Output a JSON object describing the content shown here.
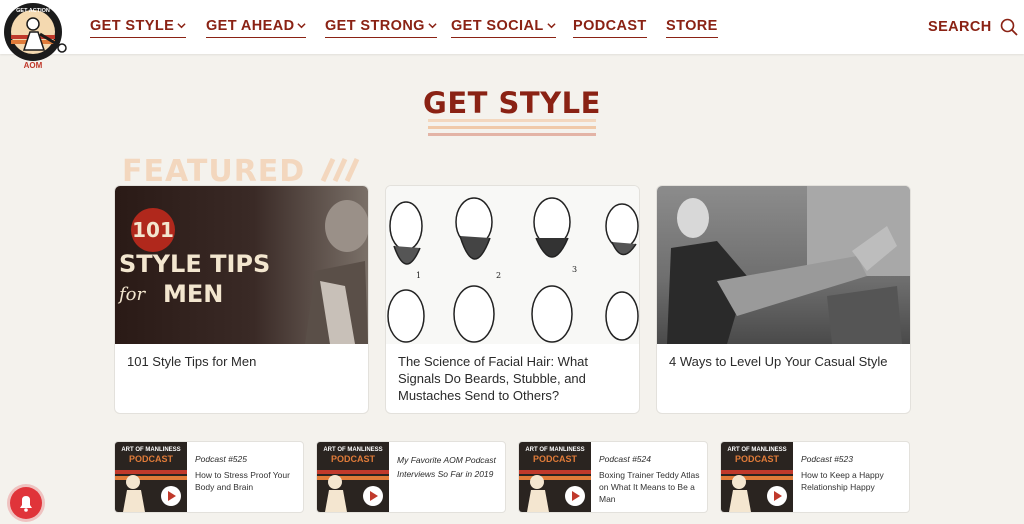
{
  "logo": {
    "text": "GET ACTION",
    "brand": "AOM"
  },
  "nav": {
    "items": [
      {
        "label": "GET STYLE",
        "has_menu": true
      },
      {
        "label": "GET AHEAD",
        "has_menu": true
      },
      {
        "label": "GET STRONG",
        "has_menu": true
      },
      {
        "label": "GET SOCIAL",
        "has_menu": true
      },
      {
        "label": "PODCAST",
        "has_menu": false
      },
      {
        "label": "STORE",
        "has_menu": false
      }
    ],
    "search_label": "SEARCH"
  },
  "page": {
    "title": "GET STYLE",
    "featured_label": "FEATURED"
  },
  "featured_cards": [
    {
      "title": "101 Style Tips for Men",
      "thumb_number": "101",
      "thumb_line1": "STYLE TIPS",
      "thumb_for": "for",
      "thumb_line2": "MEN"
    },
    {
      "title": "The Science of Facial Hair: What Signals Do Beards, Stubble, and Mustaches Send to Others?",
      "thumb_nums": [
        "1",
        "2",
        "3"
      ]
    },
    {
      "title": "4 Ways to Level Up Your Casual Style"
    }
  ],
  "podcasts": [
    {
      "category": "Podcast #525",
      "title": "How to Stress Proof Your Body and Brain"
    },
    {
      "category": "",
      "title": "My Favorite AOM Podcast Interviews So Far in 2019"
    },
    {
      "category": "Podcast #524",
      "title": "Boxing Trainer Teddy Atlas on What It Means to Be a Man"
    },
    {
      "category": "Podcast #523",
      "title": "How to Keep a Happy Relationship Happy"
    }
  ],
  "podcast_thumb": {
    "line1": "ART OF MANLINESS",
    "line2": "PODCAST"
  },
  "colors": {
    "brand": "#8a2214",
    "background": "#f4f2ed",
    "stripe1": "#f3d7be",
    "stripe2": "#e8b9a8",
    "notification": "#e0343a"
  }
}
